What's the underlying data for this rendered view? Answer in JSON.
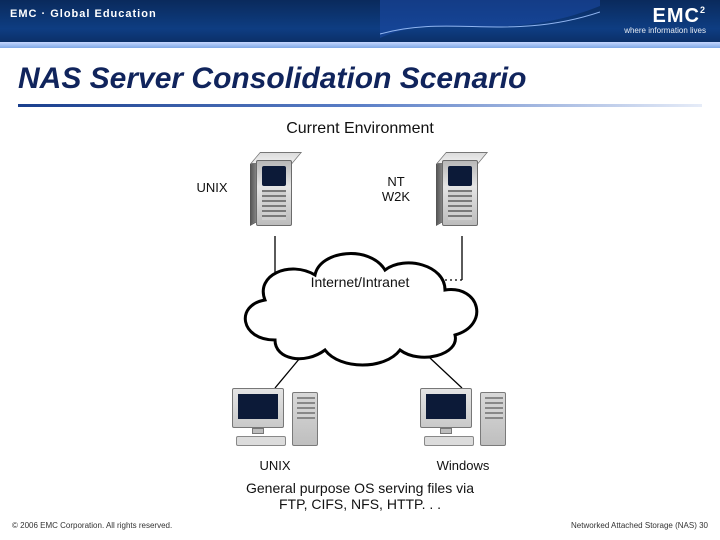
{
  "brand": {
    "left": "EMC · Global Education",
    "right_name": "EMC",
    "right_sup": "2",
    "right_tag": "where information lives"
  },
  "slide": {
    "title": "NAS Server Consolidation Scenario",
    "subheading": "Current Environment",
    "caption": "General purpose OS serving files via\nFTP, CIFS, NFS, HTTP. . ."
  },
  "diagram": {
    "server_unix_label": "UNIX",
    "server_win_label": "NT\nW2K",
    "cloud_label": "Internet/Intranet",
    "client_unix_label": "UNIX",
    "client_win_label": "Windows"
  },
  "footer": {
    "left": "© 2006 EMC Corporation. All rights reserved.",
    "right": "Networked Attached Storage (NAS) 30"
  }
}
